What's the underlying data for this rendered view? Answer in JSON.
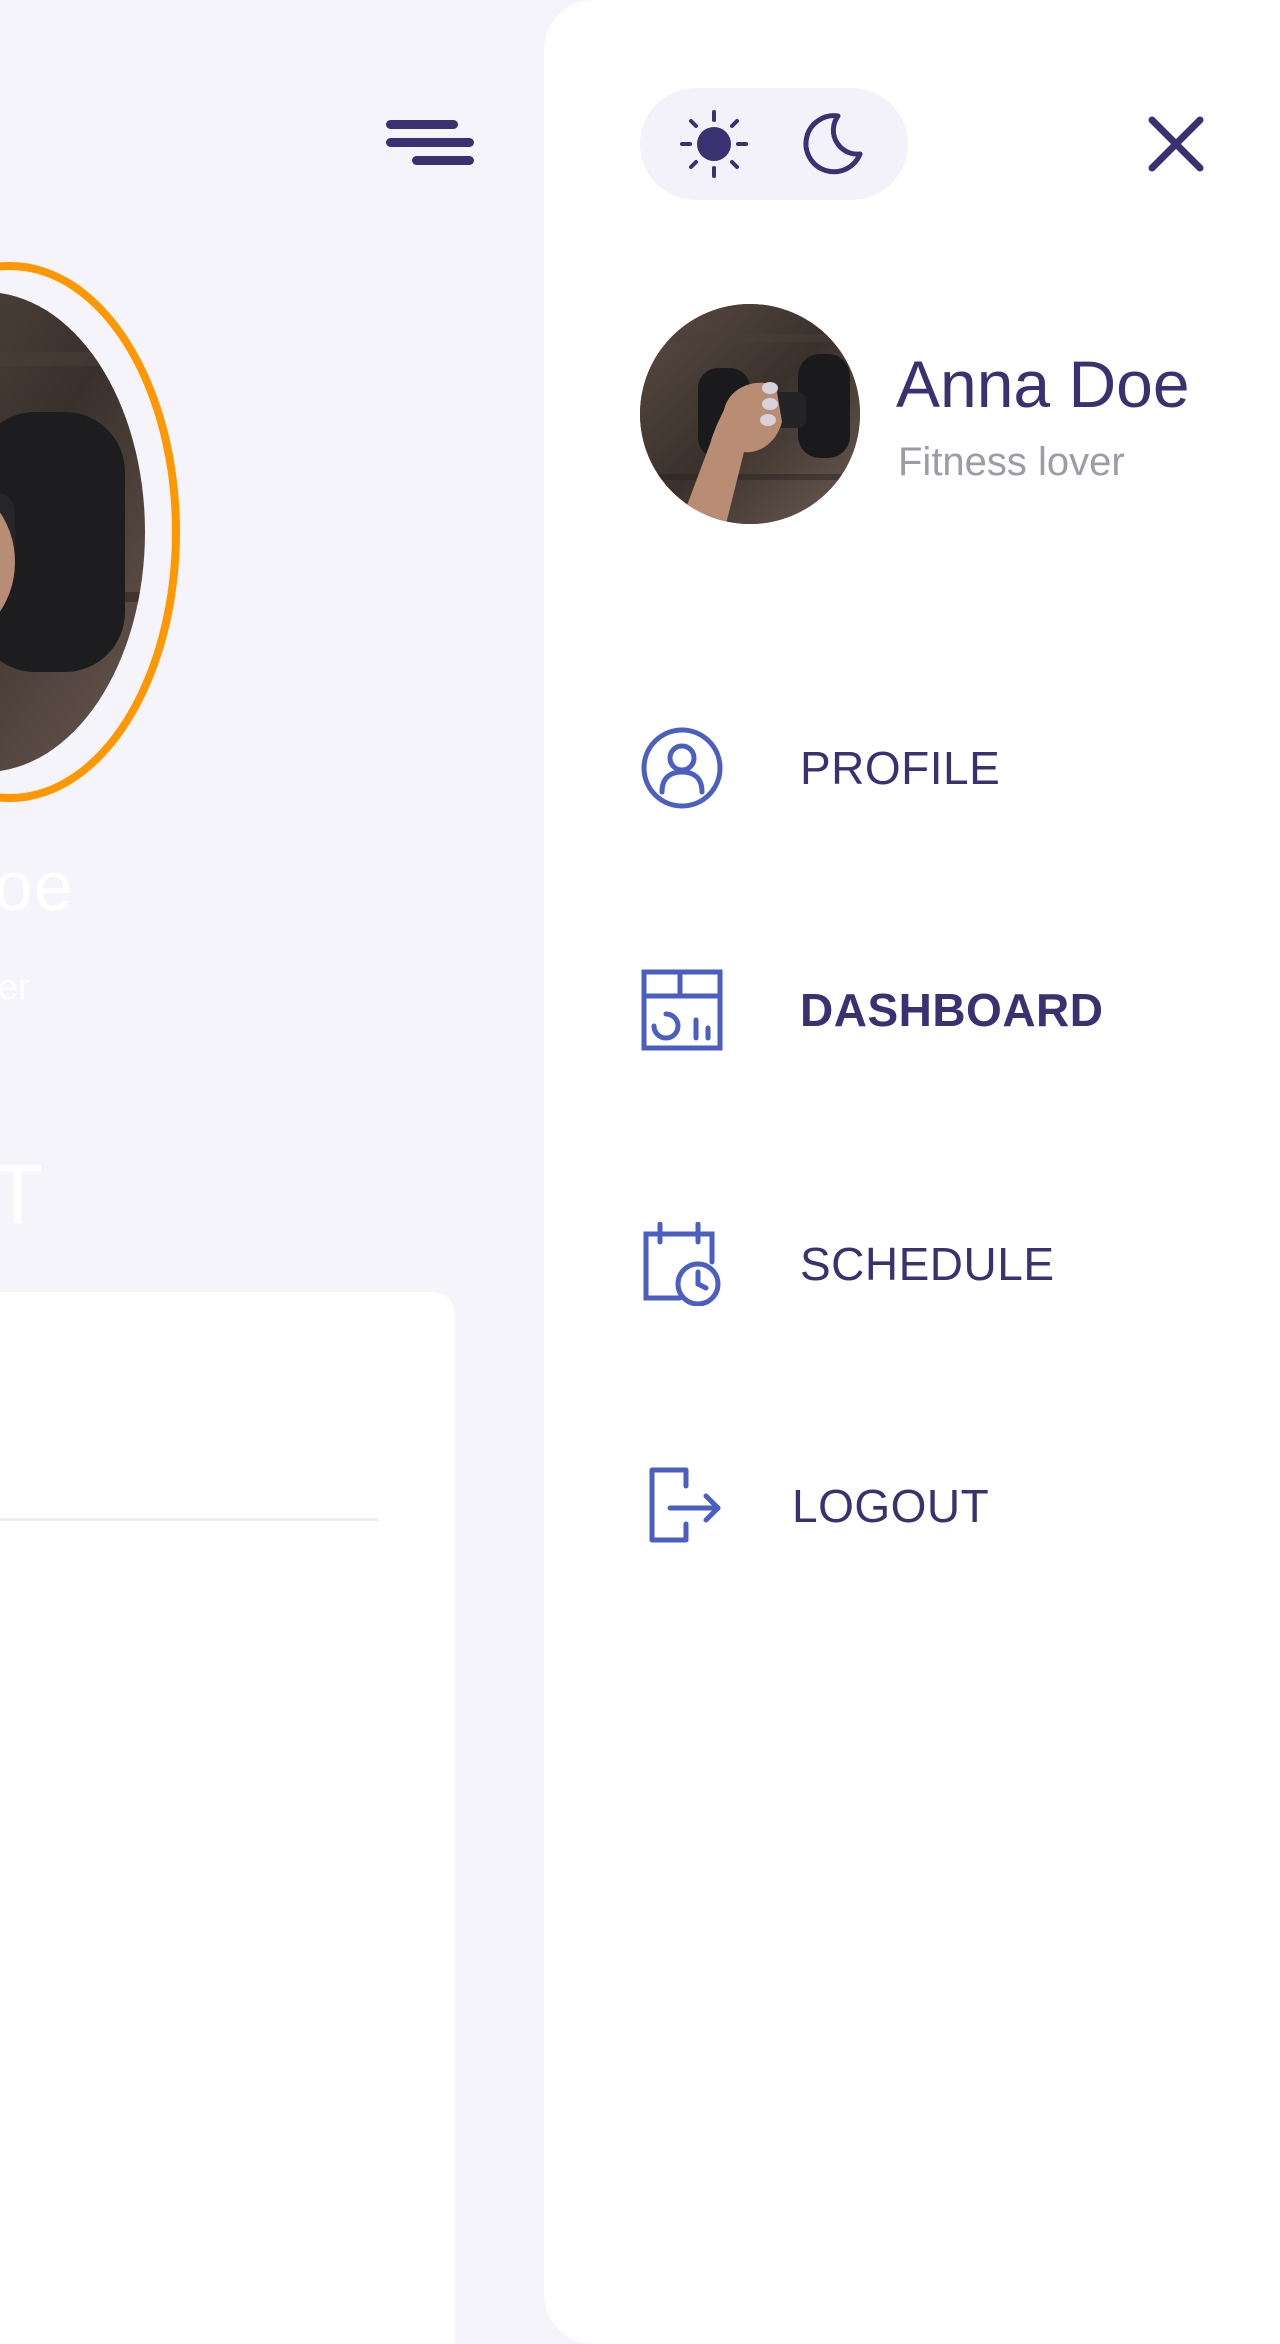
{
  "background_page": {
    "name_fragment": "oe",
    "subtitle_fragment": "er",
    "section_fragment": "T"
  },
  "drawer": {
    "theme_toggle": {
      "light_icon": "sun-icon",
      "dark_icon": "moon-icon",
      "selected": "light"
    },
    "close_icon": "close-icon",
    "user": {
      "name": "Anna Doe",
      "role": "Fitness lover"
    },
    "nav": [
      {
        "label": "PROFILE",
        "icon": "user-circle-icon",
        "active": false
      },
      {
        "label": "DASHBOARD",
        "icon": "dashboard-icon",
        "active": true
      },
      {
        "label": "SCHEDULE",
        "icon": "calendar-clock-icon",
        "active": false
      },
      {
        "label": "LOGOUT",
        "icon": "logout-icon",
        "active": false
      }
    ]
  },
  "colors": {
    "background": "#f5f4fb",
    "drawer": "#ffffff",
    "primary_text": "#3a3270",
    "muted_text": "#9d9ba6",
    "icon_blue": "#4a5fc1",
    "accent_orange": "#ff9800"
  }
}
